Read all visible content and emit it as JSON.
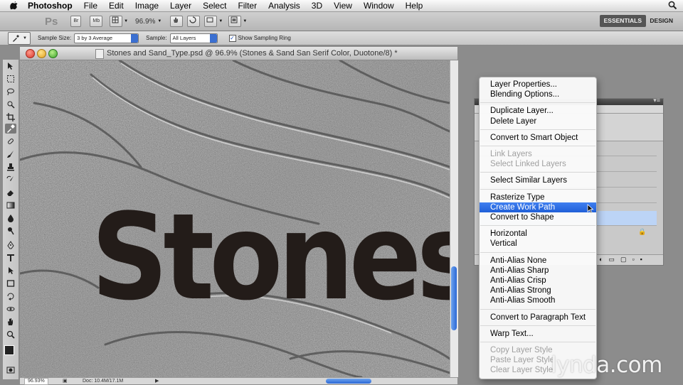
{
  "menubar": {
    "app_name": "Photoshop",
    "items": [
      "File",
      "Edit",
      "Image",
      "Layer",
      "Select",
      "Filter",
      "Analysis",
      "3D",
      "View",
      "Window",
      "Help"
    ]
  },
  "appbar": {
    "ps_logo": "Ps",
    "bridge_label": "Br",
    "minibridge_label": "Mb",
    "zoom": "96.9%",
    "workspaces": [
      "ESSENTIALS",
      "DESIGN"
    ],
    "active_workspace": "ESSENTIALS"
  },
  "options": {
    "sample_size_label": "Sample Size:",
    "sample_size_value": "3 by 3 Average",
    "sample_label": "Sample:",
    "sample_value": "All Layers",
    "show_ring_label": "Show Sampling Ring",
    "show_ring_checked": true
  },
  "document": {
    "title": "Stones and Sand_Type.psd @ 96.9% (Stones & Sand San Serif Color, Duotone/8) *",
    "canvas_text": "Stones",
    "status_zoom": "96.93%",
    "status_doc": "Doc: 10.4M/17.1M"
  },
  "context_menu": {
    "groups": [
      [
        {
          "label": "Layer Properties...",
          "enabled": true
        },
        {
          "label": "Blending Options...",
          "enabled": true
        }
      ],
      [
        {
          "label": "Duplicate Layer...",
          "enabled": true
        },
        {
          "label": "Delete Layer",
          "enabled": true
        }
      ],
      [
        {
          "label": "Convert to Smart Object",
          "enabled": true
        }
      ],
      [
        {
          "label": "Link Layers",
          "enabled": false
        },
        {
          "label": "Select Linked Layers",
          "enabled": false
        }
      ],
      [
        {
          "label": "Select Similar Layers",
          "enabled": true
        }
      ],
      [
        {
          "label": "Rasterize Type",
          "enabled": true
        },
        {
          "label": "Create Work Path",
          "enabled": true,
          "highlighted": true
        },
        {
          "label": "Convert to Shape",
          "enabled": true
        }
      ],
      [
        {
          "label": "Horizontal",
          "enabled": true
        },
        {
          "label": "Vertical",
          "enabled": true
        }
      ],
      [
        {
          "label": "Anti-Alias None",
          "enabled": true
        },
        {
          "label": "Anti-Alias Sharp",
          "enabled": true
        },
        {
          "label": "Anti-Alias Crisp",
          "enabled": true
        },
        {
          "label": "Anti-Alias Strong",
          "enabled": true
        },
        {
          "label": "Anti-Alias Smooth",
          "enabled": true
        }
      ],
      [
        {
          "label": "Convert to Paragraph Text",
          "enabled": true
        }
      ],
      [
        {
          "label": "Warp Text...",
          "enabled": true
        }
      ],
      [
        {
          "label": "Copy Layer Style",
          "enabled": false
        },
        {
          "label": "Paste Layer Style",
          "enabled": false
        },
        {
          "label": "Clear Layer Style",
          "enabled": false
        }
      ]
    ]
  },
  "watermark": "lynda.com",
  "colors": {
    "highlight": "#2a6ae0",
    "text_fill": "#221b18",
    "stone": "#a9a9a9"
  }
}
